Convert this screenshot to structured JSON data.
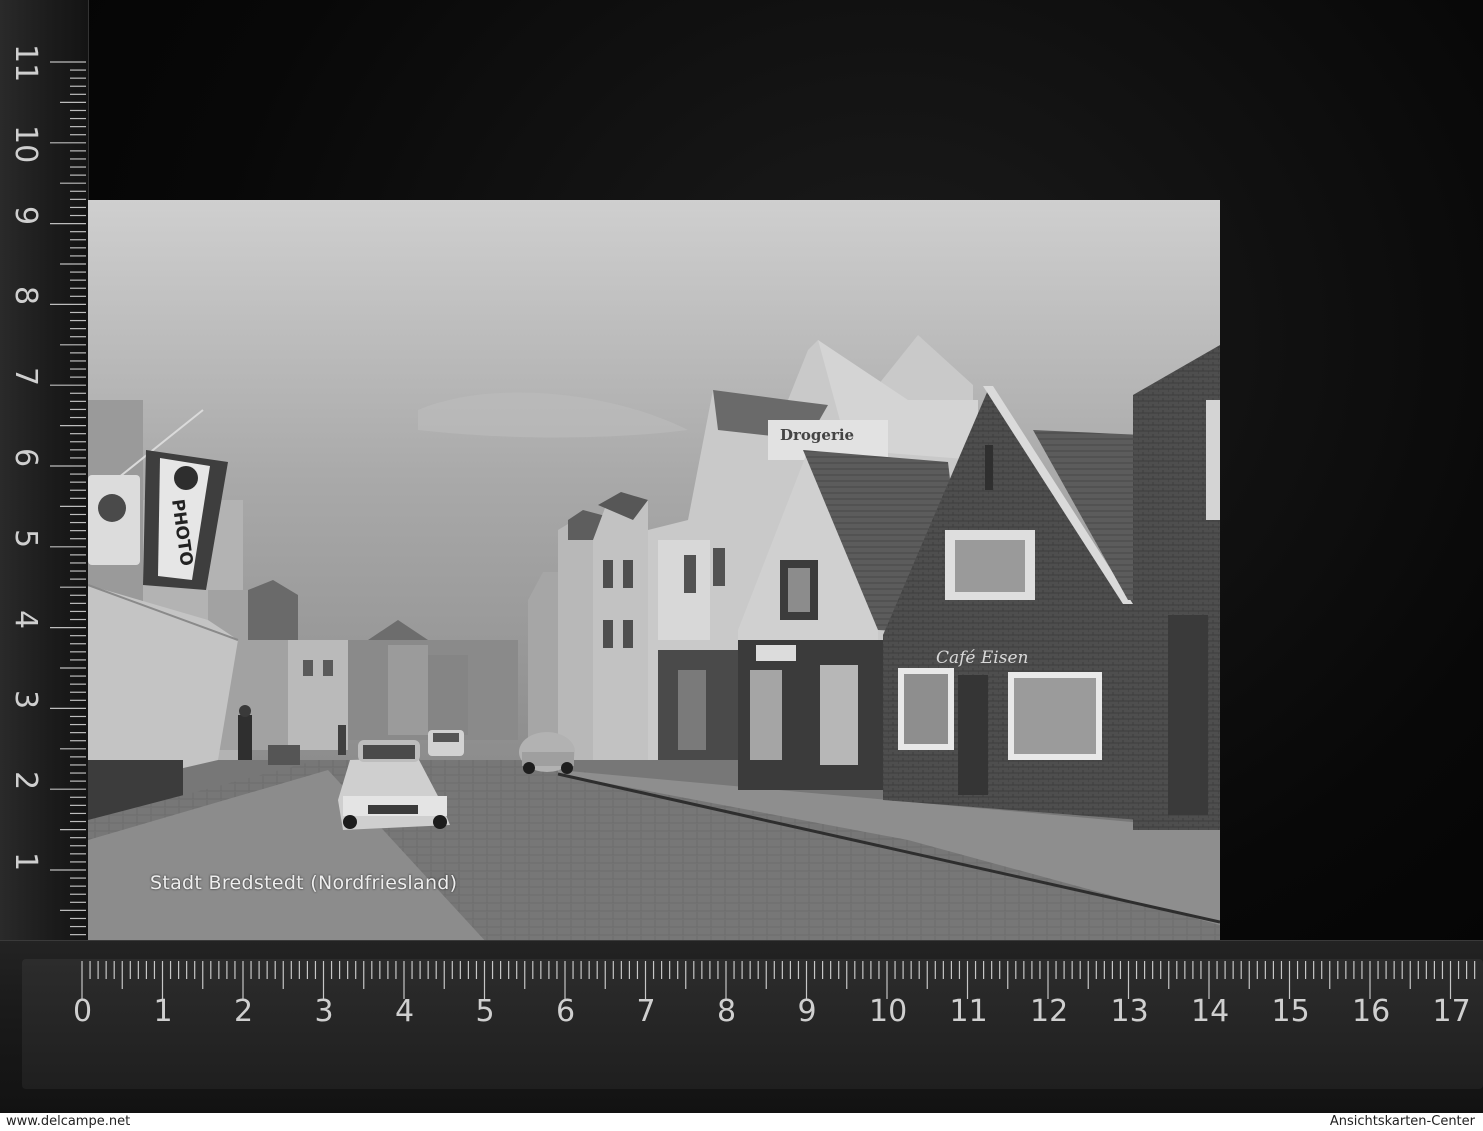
{
  "postcard": {
    "caption": "Stadt Bredstedt (Nordfriesland)",
    "signs": {
      "photo": "PHOTO",
      "drogerie": "Drogerie",
      "cafe": "Café Eisen"
    }
  },
  "ruler_horizontal": {
    "labels": [
      "0",
      "1",
      "2",
      "3",
      "4",
      "5",
      "6",
      "7",
      "8",
      "9",
      "10",
      "11",
      "12",
      "13",
      "14",
      "15",
      "16",
      "17"
    ]
  },
  "ruler_vertical": {
    "labels": [
      "11",
      "10",
      "9",
      "8",
      "7",
      "6",
      "5",
      "4",
      "3",
      "2",
      "1"
    ]
  },
  "footer": {
    "left": "www.delcampe.net",
    "right": "Ansichtskarten-Center"
  },
  "colors": {
    "background": "#000000",
    "ruler": "#1f1f1f",
    "ruler_marks": "#cfcfcf"
  }
}
